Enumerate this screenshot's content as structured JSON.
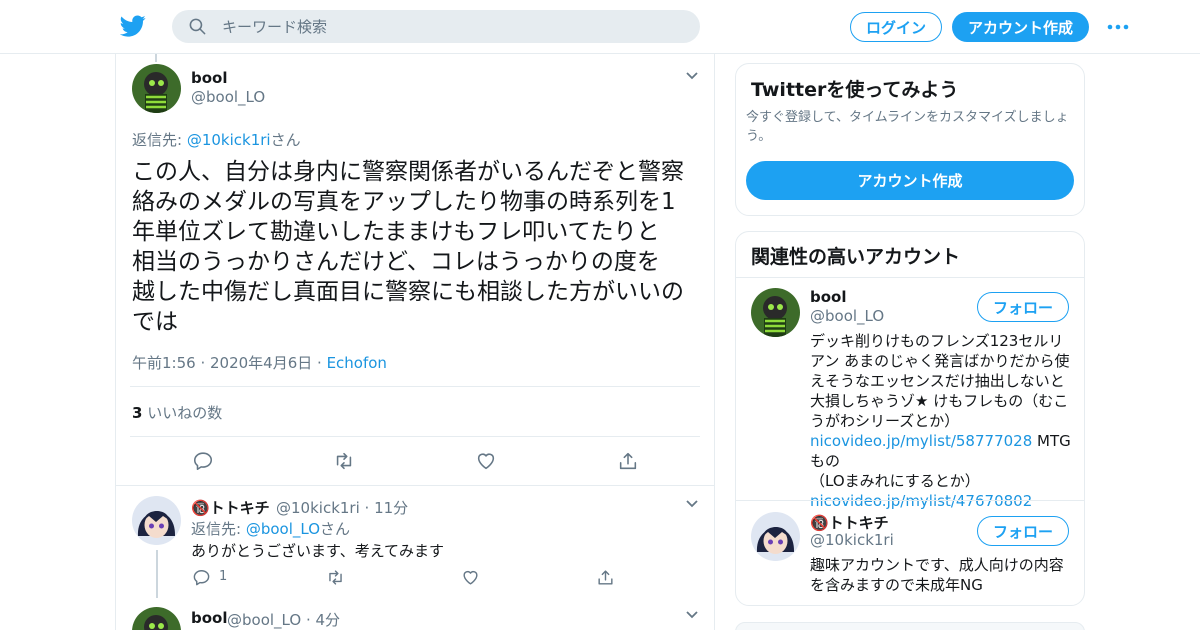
{
  "header": {
    "search_placeholder": "キーワード検索",
    "login_label": "ログイン",
    "signup_label": "アカウント作成"
  },
  "tweet": {
    "name": "bool",
    "handle": "@bool_LO",
    "reply_prefix": "返信先: ",
    "reply_handle": "@10kick1ri",
    "reply_suffix": "さん",
    "lines": [
      "この人、自分は身内に警察関係者がいるんだぞと警察",
      "絡みのメダルの写真をアップしたり物事の時系列を1",
      "年単位ズレて勘違いしたままけもフレ叩いてたりと",
      "相当のうっかりさんだけど、コレはうっかりの度を",
      "越した中傷だし真面目に警察にも相談した方がいいの",
      "では"
    ],
    "time": "午前1:56 · 2020年4月6日 · ",
    "source": "Echofon",
    "like_count": "3",
    "like_label": " いいねの数"
  },
  "reply1": {
    "name": "🔞トトキチ",
    "handle": "@10kick1ri",
    "time": "· 11分",
    "reply_prefix": "返信先: ",
    "reply_handle": "@bool_LO",
    "reply_suffix": "さん",
    "text": "ありがとうございます、考えてみます",
    "reply_count": "1"
  },
  "reply2": {
    "name": "bool",
    "handle": "@bool_LO",
    "time": "· 4分"
  },
  "sidebar": {
    "signup_card": {
      "title": "Twitterを使ってみよう",
      "desc": "今すぐ登録して、タイムラインをカスタマイズしましょう。",
      "button": "アカウント作成"
    },
    "related_card": {
      "title": "関連性の高いアカウント",
      "follow_label": "フォロー",
      "accounts": [
        {
          "name": "bool",
          "handle": "@bool_LO",
          "bio_lines": [
            "デッキ削りけものフレンズ123セルリ",
            "アン あまのじゃく発言ばかりだから使",
            "えそうなエッセンスだけ抽出しないと",
            "大損しちゃうゾ★ けもフレもの（むこ",
            "うがわシリーズとか）"
          ],
          "link1": "nicovideo.jp/mylist/58777028",
          "after_link1": " MTGもの",
          "line_after": "（LOまみれにするとか）",
          "link2": "nicovideo.jp/mylist/47670802"
        },
        {
          "name": "🔞トトキチ",
          "handle": "@10kick1ri",
          "bio_lines": [
            "趣味アカウントです、成人向けの内容",
            "を含みますので未成年NG"
          ]
        }
      ]
    }
  },
  "colors": {
    "accent": "#1da1f2",
    "link": "#1b95e0",
    "secondary_text": "#657786",
    "border": "#e6ecf0"
  },
  "icons": [
    "twitter-bird-icon",
    "search-icon",
    "more-icon",
    "chevron-down-icon",
    "reply-icon",
    "retweet-icon",
    "like-icon",
    "share-icon"
  ]
}
